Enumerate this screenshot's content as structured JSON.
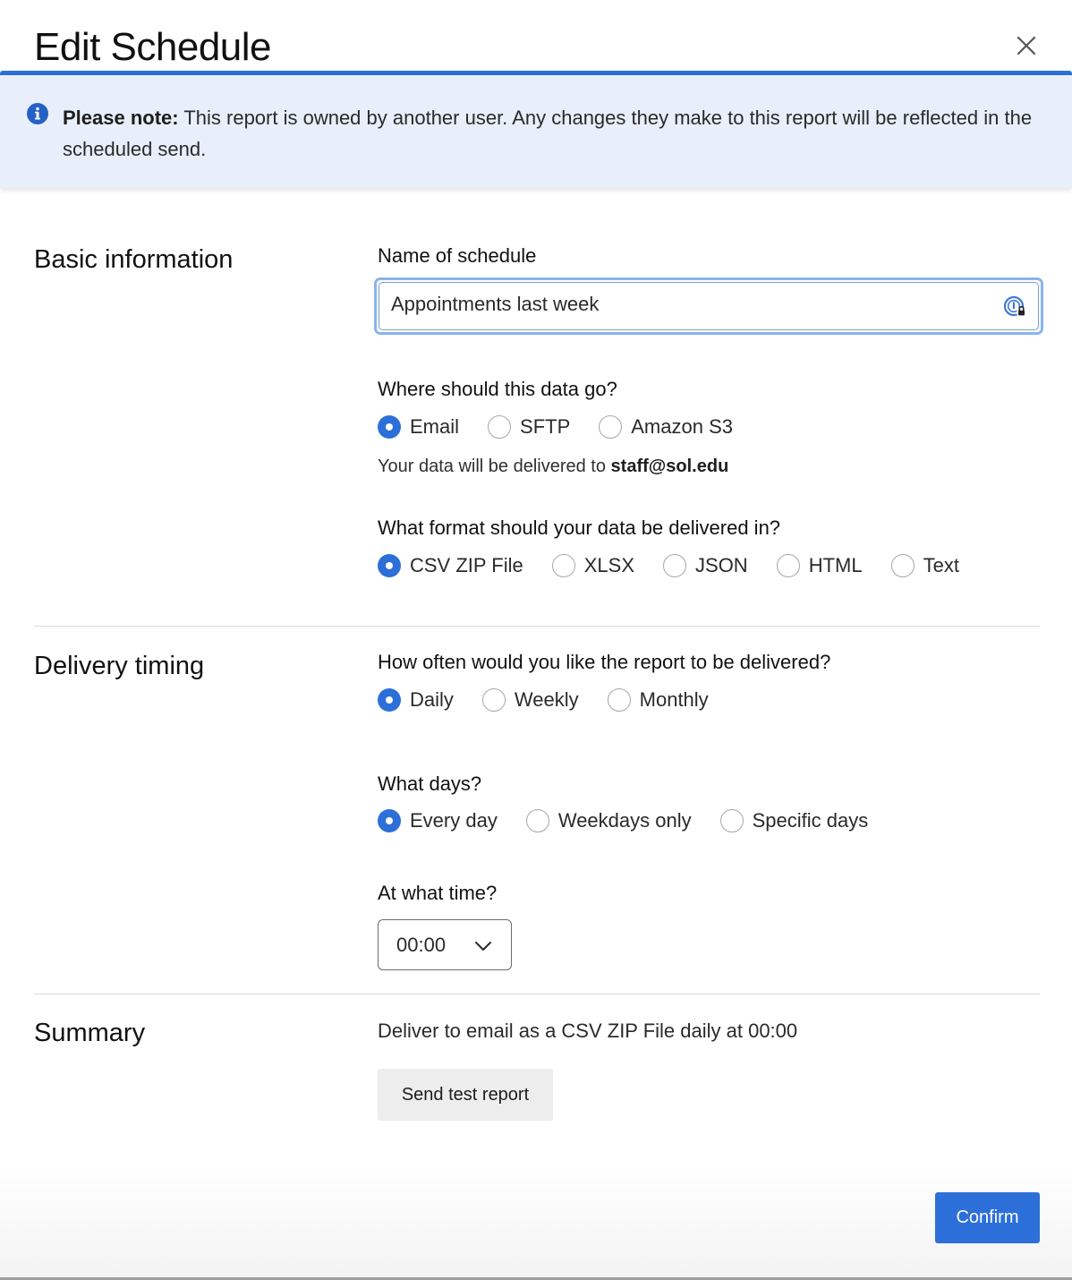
{
  "dialog": {
    "title": "Edit Schedule"
  },
  "notice": {
    "prefix": "Please note:",
    "message": "This report is owned by another user. Any changes they make to this report will be reflected in the scheduled send."
  },
  "basic_information": {
    "section_title": "Basic information",
    "name_label": "Name of schedule",
    "name_value": "Appointments last week",
    "destination_label": "Where should this data go?",
    "destination_options": [
      {
        "label": "Email",
        "checked": true
      },
      {
        "label": "SFTP",
        "checked": false
      },
      {
        "label": "Amazon S3",
        "checked": false
      }
    ],
    "delivery_note_prefix": "Your data will be delivered to ",
    "delivery_email": "staff@sol.edu",
    "format_label": "What format should your data be delivered in?",
    "format_options": [
      {
        "label": "CSV ZIP File",
        "checked": true
      },
      {
        "label": "XLSX",
        "checked": false
      },
      {
        "label": "JSON",
        "checked": false
      },
      {
        "label": "HTML",
        "checked": false
      },
      {
        "label": "Text",
        "checked": false
      }
    ]
  },
  "delivery_timing": {
    "section_title": "Delivery timing",
    "frequency_label": "How often would you like the report to be delivered?",
    "frequency_options": [
      {
        "label": "Daily",
        "checked": true
      },
      {
        "label": "Weekly",
        "checked": false
      },
      {
        "label": "Monthly",
        "checked": false
      }
    ],
    "days_label": "What days?",
    "days_options": [
      {
        "label": "Every day",
        "checked": true
      },
      {
        "label": "Weekdays only",
        "checked": false
      },
      {
        "label": "Specific days",
        "checked": false
      }
    ],
    "time_label": "At what time?",
    "time_value": "00:00"
  },
  "summary": {
    "section_title": "Summary",
    "text": "Deliver to email as a CSV ZIP File daily at 00:00",
    "test_button": "Send test report"
  },
  "footer": {
    "confirm_button": "Confirm"
  },
  "colors": {
    "accent": "#2c6fd8",
    "notice_background": "#e8effb",
    "input_focus_ring": "#8ab4ee"
  },
  "icons": {
    "close": "close-icon",
    "notice": "info-icon",
    "password_manager": "password-manager-icon",
    "select_chevron": "chevron-down-icon"
  }
}
